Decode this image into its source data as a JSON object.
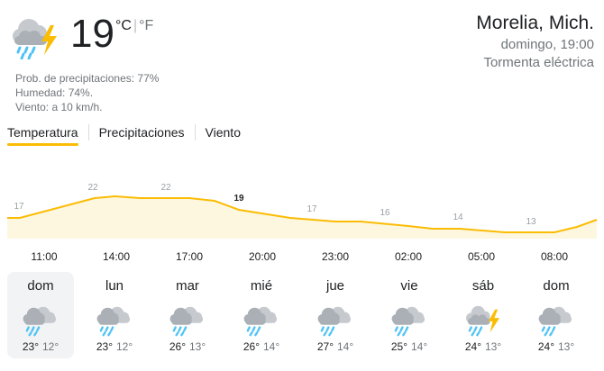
{
  "current": {
    "temp": "19",
    "unit_c": "°C",
    "unit_sep": "|",
    "unit_f": "°F",
    "icon": "thunderstorm-icon",
    "precip": "Prob. de precipitaciones: 77%",
    "humidity": "Humedad: 74%.",
    "wind": "Viento: a 10 km/h."
  },
  "location": {
    "city": "Morelia, Mich.",
    "datetime": "domingo, 19:00",
    "condition": "Tormenta eléctrica"
  },
  "tabs": [
    "Temperatura",
    "Precipitaciones",
    "Viento"
  ],
  "colors": {
    "accent": "#fbbc04",
    "area": "#fef7e0",
    "rain": "#4fc3f7",
    "bolt": "#fbbc04",
    "cloud": "#c6cacf"
  },
  "chart_data": {
    "type": "area",
    "x": [
      "11:00",
      "14:00",
      "17:00",
      "20:00",
      "23:00",
      "02:00",
      "05:00",
      "08:00"
    ],
    "values": [
      17,
      22,
      22,
      19,
      17,
      16,
      14,
      13
    ],
    "labels": [
      "17",
      "22",
      "22",
      "19",
      "17",
      "16",
      "14",
      "13"
    ],
    "highlight_index": 3,
    "grid": false
  },
  "days": [
    {
      "name": "dom",
      "icon": "rain-cloud-icon",
      "hi": "23°",
      "lo": "12°",
      "selected": true
    },
    {
      "name": "lun",
      "icon": "rain-cloud-icon",
      "hi": "23°",
      "lo": "12°"
    },
    {
      "name": "mar",
      "icon": "rain-cloud-icon",
      "hi": "26°",
      "lo": "13°"
    },
    {
      "name": "mié",
      "icon": "rain-cloud-icon",
      "hi": "26°",
      "lo": "14°"
    },
    {
      "name": "jue",
      "icon": "rain-cloud-icon",
      "hi": "27°",
      "lo": "14°"
    },
    {
      "name": "vie",
      "icon": "rain-cloud-icon",
      "hi": "25°",
      "lo": "14°"
    },
    {
      "name": "sáb",
      "icon": "thunderstorm-icon",
      "hi": "24°",
      "lo": "13°"
    },
    {
      "name": "dom",
      "icon": "rain-cloud-icon",
      "hi": "24°",
      "lo": "13°"
    }
  ]
}
